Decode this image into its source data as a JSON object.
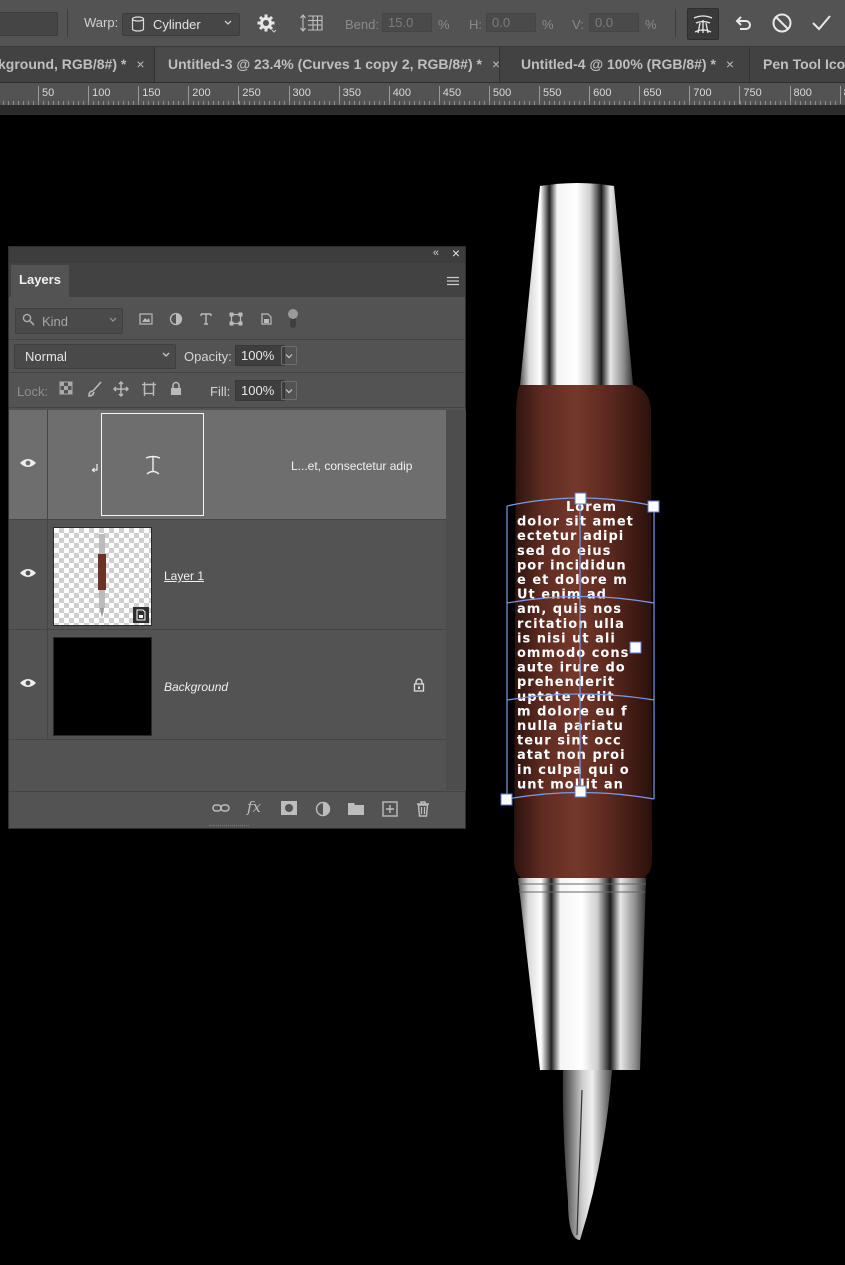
{
  "options_bar": {
    "warp_label": "Warp:",
    "warp_style": "Cylinder",
    "bend_label": "Bend:",
    "bend_value": "15.0",
    "h_label": "H:",
    "h_value": "0.0",
    "v_label": "V:",
    "v_value": "0.0",
    "percent": "%"
  },
  "tabs": [
    {
      "label": "kground, RGB/8#) *",
      "close": "×"
    },
    {
      "label": "Untitled-3 @ 23.4% (Curves 1 copy 2, RGB/8#) *",
      "close": "×"
    },
    {
      "label": "Untitled-4 @ 100% (RGB/8#) *",
      "close": "×"
    },
    {
      "label": "Pen Tool Icon"
    }
  ],
  "ruler_ticks": [
    "50",
    "100",
    "150",
    "200",
    "250",
    "300",
    "350",
    "400",
    "450",
    "500",
    "550",
    "600",
    "650",
    "700",
    "750",
    "800",
    "8"
  ],
  "warp_text": [
    "Lorem",
    "dolor sit amet",
    "ectetur adipi",
    "sed do eius",
    "por incididun",
    "e et dolore m",
    "Ut enim ad",
    "am, quis nos",
    "rcitation ulla",
    "is nisi ut ali",
    "ommodo cons",
    "aute irure do",
    "prehenderit",
    "uptate velit",
    "m dolore eu f",
    "nulla pariatu",
    "teur sint occ",
    "atat non proi",
    "in culpa qui o",
    "unt mollit an"
  ],
  "layers_panel": {
    "collapse": "«",
    "close": "×",
    "tab_label": "Layers",
    "kind_label": "Kind",
    "blend_mode": "Normal",
    "opacity_label": "Opacity:",
    "opacity_value": "100%",
    "lock_label": "Lock:",
    "fill_label": "Fill:",
    "fill_value": "100%",
    "layers": [
      {
        "name": "L...et, consectetur adip",
        "type": "warped-text",
        "selected": true
      },
      {
        "name": "Layer 1",
        "type": "smart-object"
      },
      {
        "name": "Background",
        "type": "background",
        "locked": true
      }
    ]
  },
  "colors": {
    "canvas": "#000000",
    "panel": "#535353",
    "selected_row": "#6e6e6e",
    "warp_mesh": "#7a9ae6",
    "wood": "#5b2a20"
  }
}
